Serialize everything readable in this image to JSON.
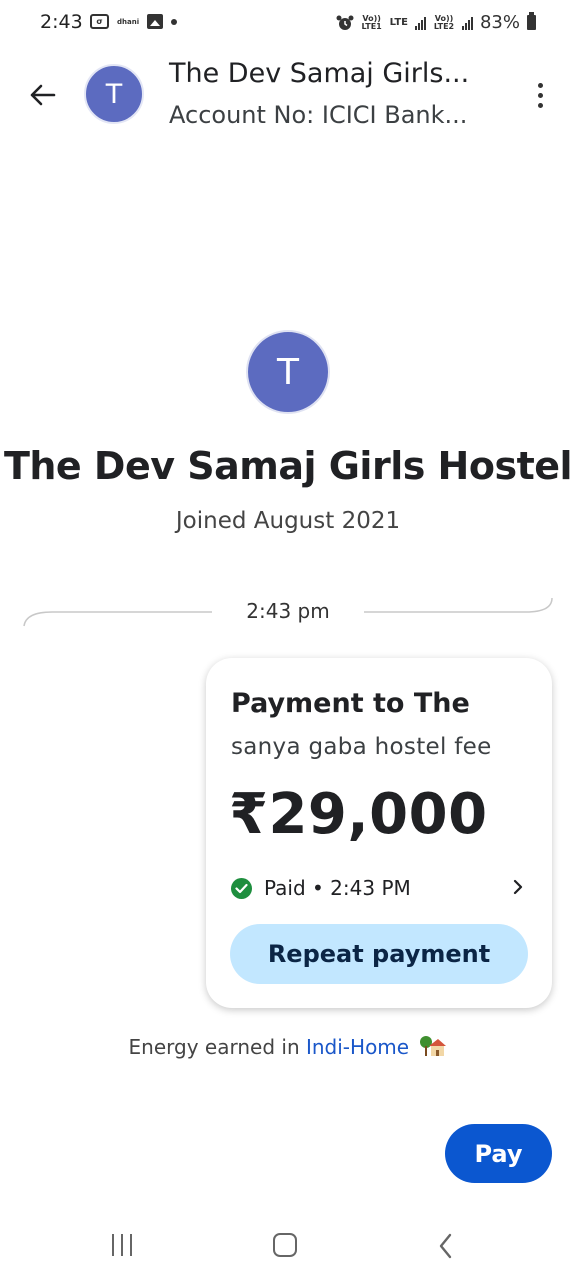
{
  "status_bar": {
    "time": "2:43",
    "app_icon_text": "dhani",
    "lte_label": "LTE",
    "volte1": "Vo)) LTE1",
    "volte2": "Vo)) LTE2",
    "battery": "83%"
  },
  "header": {
    "avatar_letter": "T",
    "title": "The Dev Samaj Girls...",
    "subtitle": "Account No: ICICI Bank..."
  },
  "profile": {
    "avatar_letter": "T",
    "name": "The Dev Samaj Girls Hostel",
    "joined": "Joined August 2021"
  },
  "divider": {
    "time": "2:43 pm"
  },
  "payment": {
    "title": "Payment to The",
    "note": "sanya gaba hostel fee",
    "amount": "₹29,000",
    "status": "Paid • 2:43 PM",
    "repeat_label": "Repeat payment",
    "status_color": "#1e8e3e"
  },
  "energy": {
    "prefix": "Energy earned in",
    "link": "Indi-Home",
    "icon": "house-with-tree-icon"
  },
  "pay_button": {
    "label": "Pay",
    "color": "#0b57d0"
  },
  "nav": {
    "recents_icon": "recents-icon",
    "home_icon": "home-icon",
    "back_icon": "back-icon"
  }
}
